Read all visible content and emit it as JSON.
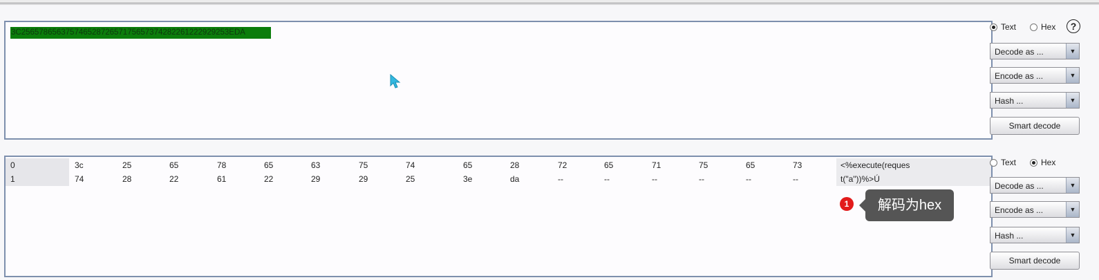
{
  "input_panel": {
    "selected_text": "3C25657865637574652872657175657374282261222929253EDA"
  },
  "hex_view": {
    "rows": [
      {
        "offset": "0",
        "bytes": [
          "3c",
          "25",
          "65",
          "78",
          "65",
          "63",
          "75",
          "74",
          "65",
          "28",
          "72",
          "65",
          "71",
          "75",
          "65",
          "73"
        ],
        "ascii": "<%execute(reques"
      },
      {
        "offset": "1",
        "bytes": [
          "74",
          "28",
          "22",
          "61",
          "22",
          "29",
          "29",
          "25",
          "3e",
          "da",
          "--",
          "--",
          "--",
          "--",
          "--",
          "--"
        ],
        "ascii": "t(\"a\"))%>Ú"
      }
    ]
  },
  "controls_top": {
    "radio_text": "Text",
    "radio_hex": "Hex",
    "selected": "text",
    "help": "?",
    "decode_label": "Decode as ...",
    "encode_label": "Encode as ...",
    "hash_label": "Hash ...",
    "smart_decode": "Smart decode"
  },
  "controls_bottom": {
    "radio_text": "Text",
    "radio_hex": "Hex",
    "selected": "hex",
    "decode_label": "Decode as ...",
    "encode_label": "Encode as ...",
    "hash_label": "Hash ...",
    "smart_decode": "Smart decode"
  },
  "annotation": {
    "badge": "1",
    "text": "解码为hex"
  }
}
